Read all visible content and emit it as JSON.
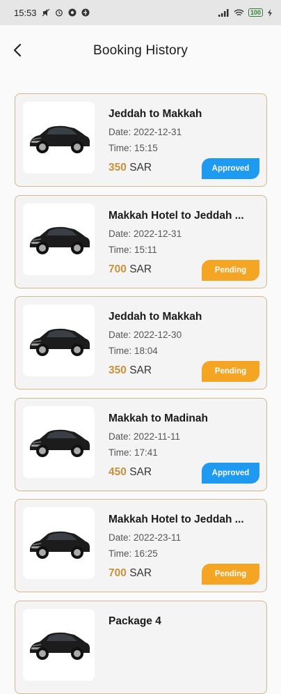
{
  "status_bar": {
    "time": "15:53",
    "battery": "100"
  },
  "header": {
    "title": "Booking History"
  },
  "colors": {
    "approved": "#1e9af0",
    "pending": "#f5a524",
    "price": "#c8913a",
    "border": "#d4b78c"
  },
  "bookings": [
    {
      "route": "Jeddah to Makkah",
      "date": "Date: 2022-12-31",
      "time": "Time: 15:15",
      "amount": "350",
      "currency": "SAR",
      "status": "Approved",
      "status_class": "approved"
    },
    {
      "route": "Makkah Hotel to Jeddah ...",
      "date": "Date: 2022-12-31",
      "time": "Time: 15:11",
      "amount": "700",
      "currency": "SAR",
      "status": "Pending",
      "status_class": "pending"
    },
    {
      "route": "Jeddah to Makkah",
      "date": "Date: 2022-12-30",
      "time": "Time: 18:04",
      "amount": "350",
      "currency": "SAR",
      "status": "Pending",
      "status_class": "pending"
    },
    {
      "route": "Makkah to Madinah",
      "date": "Date: 2022-11-11",
      "time": "Time: 17:41",
      "amount": "450",
      "currency": "SAR",
      "status": "Approved",
      "status_class": "approved"
    },
    {
      "route": "Makkah Hotel to Jeddah ...",
      "date": "Date: 2022-23-11",
      "time": "Time: 16:25",
      "amount": "700",
      "currency": "SAR",
      "status": "Pending",
      "status_class": "pending"
    },
    {
      "route": "Package 4",
      "date": "",
      "time": "",
      "amount": "",
      "currency": "",
      "status": "",
      "status_class": ""
    }
  ]
}
